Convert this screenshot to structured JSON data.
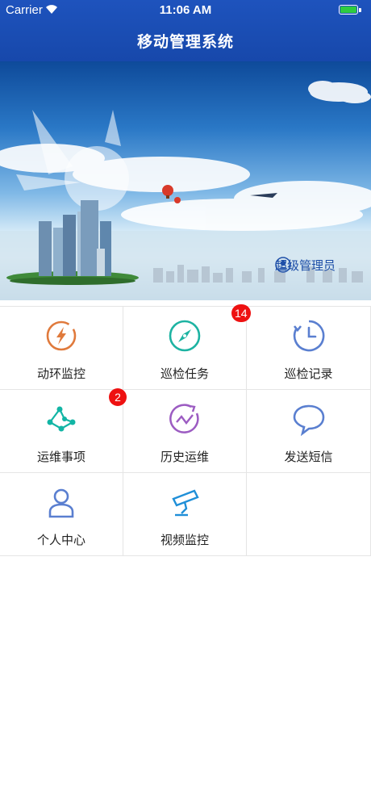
{
  "status_bar": {
    "carrier": "Carrier",
    "time": "11:06 AM"
  },
  "header": {
    "title": "移动管理系统"
  },
  "banner": {
    "user_label": "超级管理员"
  },
  "menu": {
    "items": [
      {
        "label": "动环监控",
        "icon": "lightning-icon",
        "color": "#e07a3c"
      },
      {
        "label": "巡检任务",
        "icon": "compass-icon",
        "color": "#1db3a2",
        "badge": "14"
      },
      {
        "label": "巡检记录",
        "icon": "clock-history-icon",
        "color": "#5a7fd0"
      },
      {
        "label": "运维事项",
        "icon": "network-nodes-icon",
        "color": "#12b5a5",
        "badge": "2"
      },
      {
        "label": "历史运维",
        "icon": "history-trend-icon",
        "color": "#9c5cc2"
      },
      {
        "label": "发送短信",
        "icon": "chat-bubble-icon",
        "color": "#5a7fd0"
      },
      {
        "label": "个人中心",
        "icon": "user-icon",
        "color": "#5a7fd0"
      },
      {
        "label": "视频监控",
        "icon": "camera-icon",
        "color": "#1f8fd8"
      }
    ]
  }
}
